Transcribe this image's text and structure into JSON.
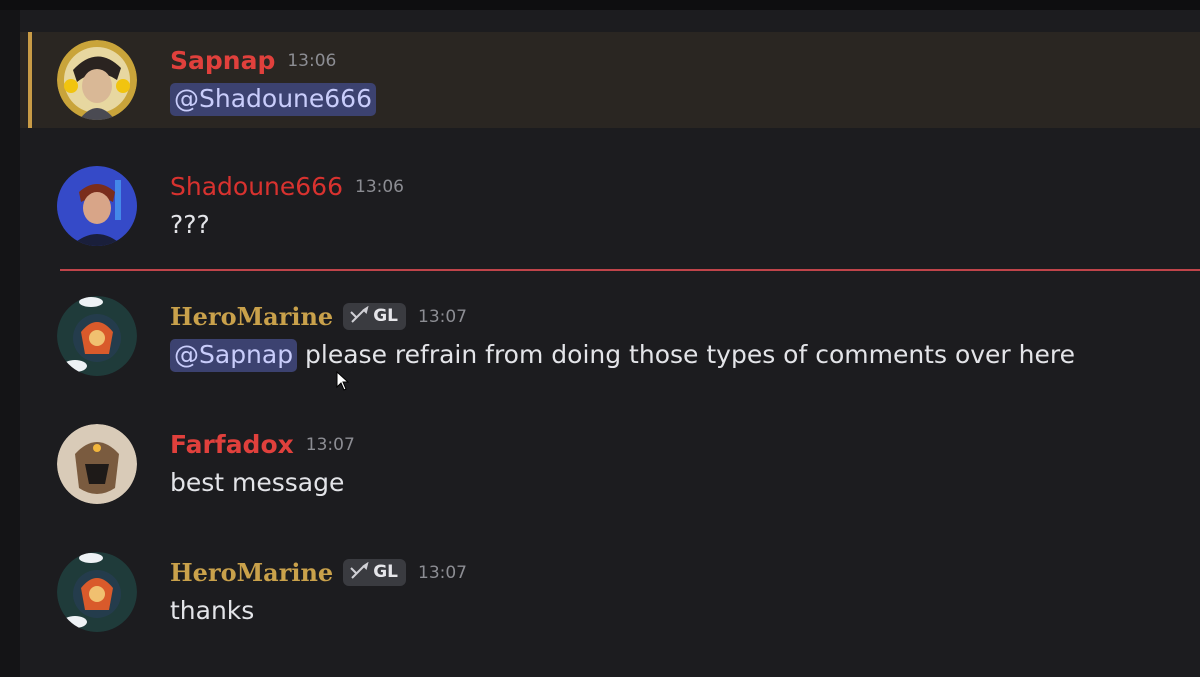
{
  "colors": {
    "background": "#1c1c1f",
    "highlight_background": "#2a2622",
    "mention_bar": "#c89b46",
    "new_messages_divider": "#c0444a",
    "mention_background": "#3c4270",
    "mention_text": "#c9cdfb",
    "name_red": "#e0403c",
    "name_gold": "#c9a14b"
  },
  "messages": [
    {
      "username": "Sapnap",
      "name_color": "#e0403c",
      "timestamp": "13:06",
      "role_tag": null,
      "mention": "@Shadoune666",
      "text": "",
      "avatar_icon": "user-avatar-icon",
      "highlighted": true
    },
    {
      "username": "Shadoune666",
      "name_color": "#d8322f",
      "timestamp": "13:06",
      "role_tag": null,
      "mention": null,
      "text": "???",
      "avatar_icon": "user-avatar-icon",
      "highlighted": false
    },
    {
      "username": "HeroMarine",
      "name_color": "#c9a14b",
      "timestamp": "13:07",
      "role_tag": "GL",
      "role_icon": "crossed-swords-icon",
      "mention": "@Sapnap",
      "text": " please refrain from doing those types of comments over here",
      "avatar_icon": "user-avatar-icon",
      "highlighted": false
    },
    {
      "username": "Farfadox",
      "name_color": "#e0403c",
      "timestamp": "13:07",
      "role_tag": null,
      "mention": null,
      "text": "best message",
      "avatar_icon": "user-avatar-icon",
      "highlighted": false
    },
    {
      "username": "HeroMarine",
      "name_color": "#c9a14b",
      "timestamp": "13:07",
      "role_tag": "GL",
      "role_icon": "crossed-swords-icon",
      "mention": null,
      "text": "thanks",
      "avatar_icon": "user-avatar-icon",
      "highlighted": false
    }
  ]
}
